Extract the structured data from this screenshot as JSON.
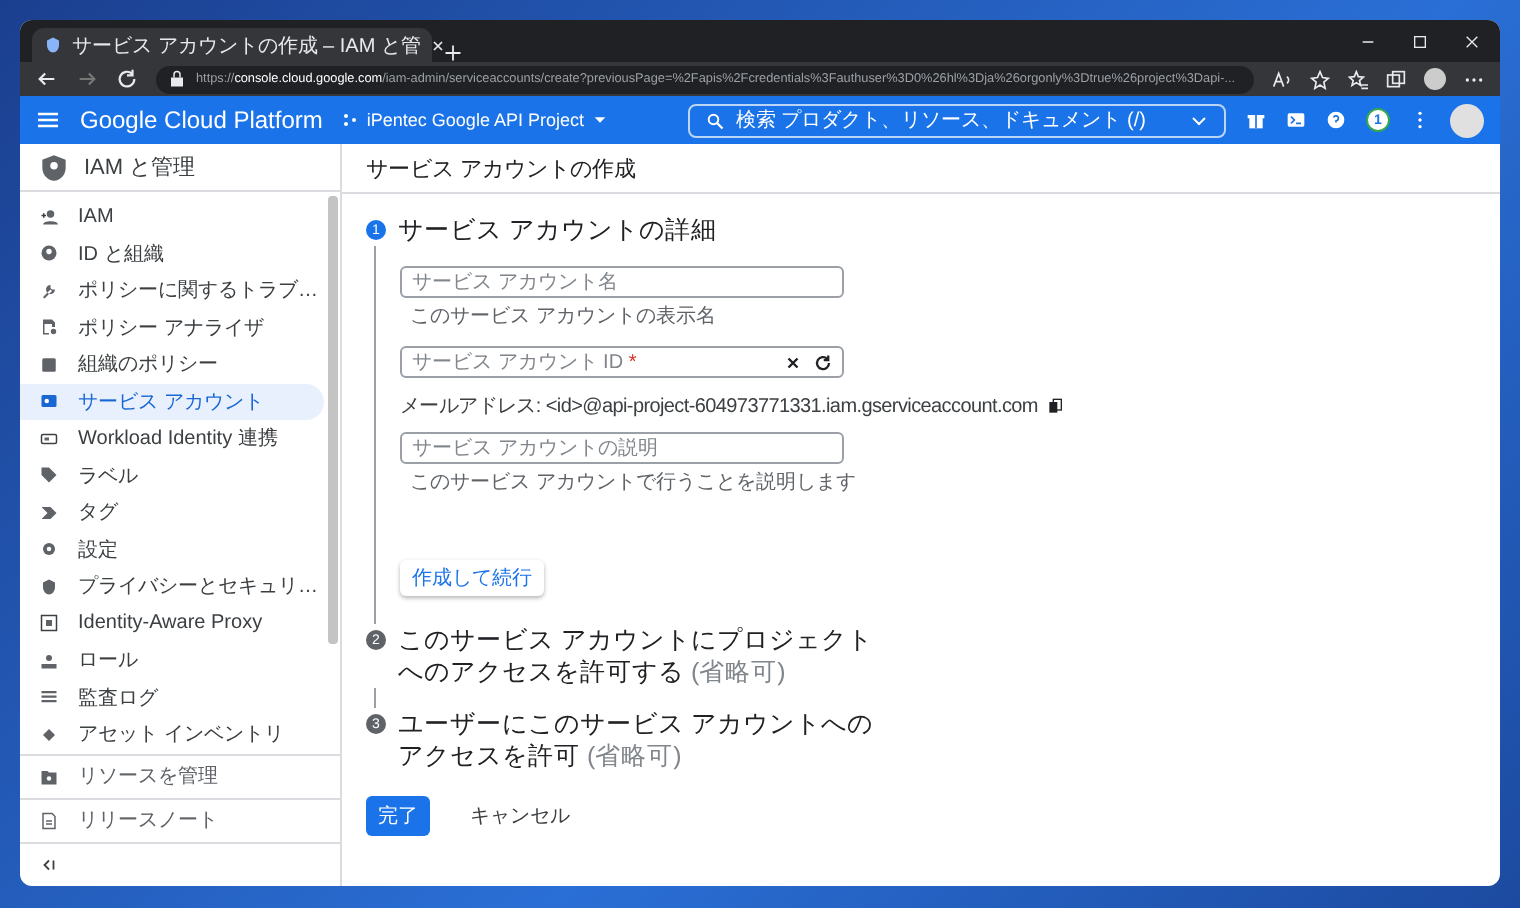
{
  "browser": {
    "tab": {
      "title": "サービス アカウントの作成 – IAM と管"
    },
    "url": {
      "scheme": "https://",
      "host": "console.cloud.google.com",
      "path": "/iam-admin/serviceaccounts/create?previousPage=%2Fapis%2Fcredentials%3Fauthuser%3D0%26hl%3Dja%26orgonly%3Dtrue%26project%3Dapi-..."
    }
  },
  "header": {
    "product": "Google Cloud Platform",
    "project": "iPentec Google API Project",
    "search_placeholder": "検索  プロダクト、リソース、ドキュメント (/)",
    "notification_count": "1"
  },
  "sidebar": {
    "title": "IAM と管理",
    "items": [
      {
        "label": "IAM",
        "selected": false
      },
      {
        "label": "ID と組織",
        "selected": false
      },
      {
        "label": "ポリシーに関するトラブ…",
        "selected": false
      },
      {
        "label": "ポリシー アナライザ",
        "selected": false
      },
      {
        "label": "組織のポリシー",
        "selected": false
      },
      {
        "label": "サービス アカウント",
        "selected": true
      },
      {
        "label": "Workload Identity 連携",
        "selected": false
      },
      {
        "label": "ラベル",
        "selected": false
      },
      {
        "label": "タグ",
        "selected": false
      },
      {
        "label": "設定",
        "selected": false
      },
      {
        "label": "プライバシーとセキュリ…",
        "selected": false
      },
      {
        "label": "Identity-Aware Proxy",
        "selected": false
      },
      {
        "label": "ロール",
        "selected": false
      },
      {
        "label": "監査ログ",
        "selected": false
      },
      {
        "label": "アセット インベントリ",
        "selected": false
      }
    ],
    "footer": [
      {
        "label": "リソースを管理"
      },
      {
        "label": "リリースノート"
      }
    ]
  },
  "page": {
    "title": "サービス アカウントの作成",
    "steps": [
      {
        "number": "1",
        "title": "サービス アカウントの詳細",
        "active": true,
        "fields": [
          {
            "kind": "text",
            "placeholder": "サービス アカウント名",
            "helper": "このサービス アカウントの表示名"
          },
          {
            "kind": "id",
            "placeholder": "サービス アカウント ID",
            "required_mark": "*",
            "note": "メールアドレス: <id>@api-project-604973771331.iam.gserviceaccount.com"
          },
          {
            "kind": "text",
            "placeholder": "サービス アカウントの説明",
            "helper": "このサービス アカウントで行うことを説明します"
          }
        ],
        "button": "作成して続行"
      },
      {
        "number": "2",
        "title": "このサービス アカウントにプロジェクトへのアクセスを許可する",
        "optional": "(省略可)",
        "active": false
      },
      {
        "number": "3",
        "title": "ユーザーにこのサービス アカウントへのアクセスを許可",
        "optional": "(省略可)",
        "active": false
      }
    ],
    "actions": [
      {
        "label": "完了",
        "primary": true
      },
      {
        "label": "キャンセル",
        "primary": false
      }
    ]
  }
}
